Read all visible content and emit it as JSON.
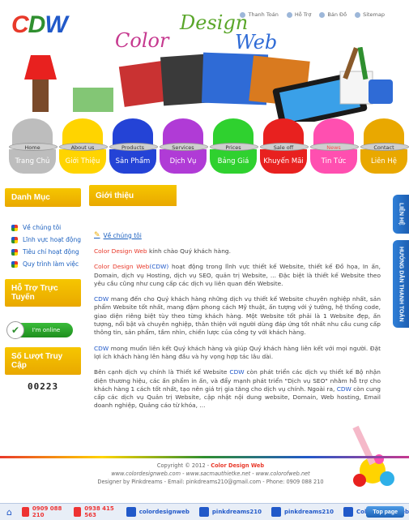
{
  "header": {
    "logo_text": "CDW",
    "brand_words": [
      "Color",
      "Design",
      "Web"
    ],
    "top_links": [
      {
        "label": "Thanh Toán",
        "icon": "payment-icon"
      },
      {
        "label": "Hỗ Trợ",
        "icon": "support-icon"
      },
      {
        "label": "Bản Đồ",
        "icon": "map-icon"
      },
      {
        "label": "Sitemap",
        "icon": "sitemap-icon"
      }
    ]
  },
  "nav": [
    {
      "sub": "Home",
      "label": "Trang Chủ",
      "color": "#bdbdbd"
    },
    {
      "sub": "About us",
      "label": "Giới Thiệu",
      "color": "#ffd400"
    },
    {
      "sub": "Products",
      "label": "Sản Phẩm",
      "color": "#2443d6"
    },
    {
      "sub": "Services",
      "label": "Dịch Vụ",
      "color": "#b03bd6"
    },
    {
      "sub": "Prices",
      "label": "Bảng Giá",
      "color": "#2fd12f"
    },
    {
      "sub": "Sale off",
      "label": "Khuyến Mãi",
      "color": "#e8211f"
    },
    {
      "sub": "News",
      "label": "Tin Tức",
      "color": "#ff4fb0",
      "active": true
    },
    {
      "sub": "Contact",
      "label": "Liên Hệ",
      "color": "#e9a800"
    }
  ],
  "sidebar": {
    "menu_title": "Danh Mục",
    "items": [
      "Về chúng tôi",
      "Lĩnh vực hoạt động",
      "Tiêu chí hoạt động",
      "Quy trình làm việc"
    ],
    "support_title": "Hỗ Trợ Trực Tuyến",
    "online_label": "I'm online",
    "visits_title": "Số Lượt Truy Cập",
    "visit_count": "00223"
  },
  "main": {
    "section_title": "Giới thiệu",
    "subtitle": "Về chúng tôi",
    "p1_a": "Color Design Web",
    "p1_b": " kính chào Quý khách hàng.",
    "p2_a": "Color Design Web",
    "p2_b": "(CDW)",
    "p2_c": " hoạt động trong lĩnh vực thiết kế Website, thiết kế Đồ họa, In ấn, Domain, dịch vụ Hosting, dịch vụ SEO, quản trị Website, ... Đặc biệt là thiết kế Website theo yêu cầu cũng như cung cấp các dịch vụ liên quan đến Website.",
    "p3_a": "CDW",
    "p3_b": " mang đến cho Quý khách hàng những dịch vụ thiết kế Website chuyên nghiệp nhất, sản phẩm Website tốt nhất, mang đậm phong cách Mỹ thuật, ấn tượng với ý tưởng, hệ thống code, giao diện riêng biệt tùy theo từng khách hàng. Một Website tốt phải là 1 Website đẹp, ấn tượng, nổi bật và chuyên nghiệp, thân thiện với người dùng đáp ứng tốt nhất nhu cầu cung cấp thông tin, sản phẩm, tầm nhìn, chiến lược của công ty với khách hàng.",
    "p4_a": "CDW",
    "p4_b": " mong muốn liên kết Quý khách hàng và giúp Quý khách hàng liên kết với mọi người. Đặt lợi ích khách hàng lên hàng đầu và hy vọng hợp tác lâu dài.",
    "p5_a": "Bên cạnh dịch vụ chính là Thiết kế Website ",
    "p5_b": "CDW",
    "p5_c": " còn phát triển các dịch vụ thiết kế Bộ nhận diện thương hiệu, các ấn phẩm in ấn, và đẩy mạnh phát triển \"Dịch vụ SEO\" nhằm hỗ trợ cho khách hàng 1 cách tốt nhất, tạo nên giá trị gia tăng cho dịch vụ chính. Ngoài ra, ",
    "p5_d": "CDW",
    "p5_e": " còn cung cấp các dịch vụ Quản trị Website, cập nhật nội dung website, Domain, Web hosting, Email doanh nghiệp, Quảng cáo từ khóa, ..."
  },
  "right_tabs": [
    "LIÊN HỆ",
    "HƯỚNG DẪN THANH TOÁN"
  ],
  "footer": {
    "copyright": "Copyright © 2012 - ",
    "copyright_brand": "Color Design Web",
    "sites": "www.colordesignweb.com - www.sacmauthietke.net - www.colorofweb.net",
    "designer_line": "Designer by Pinkdreams - Email: pinkdreams210@gmail.com - Phone: 0909 088 210"
  },
  "bottom_bar": {
    "items": [
      {
        "label": "0909 088 210",
        "icon": "phone-icon",
        "color": "#e33"
      },
      {
        "label": "0938 415 563",
        "icon": "phone-icon",
        "color": "#e33"
      },
      {
        "label": "colordesignweb",
        "icon": "skype-icon",
        "color": "#2159c9"
      },
      {
        "label": "pinkdreams210",
        "icon": "yahoo-icon",
        "color": "#2159c9"
      },
      {
        "label": "pinkdreams210",
        "icon": "skype-icon",
        "color": "#2159c9"
      },
      {
        "label": "ColorDesignWeb",
        "icon": "facebook-icon",
        "color": "#2159c9"
      }
    ],
    "top_page_label": "Top page"
  }
}
